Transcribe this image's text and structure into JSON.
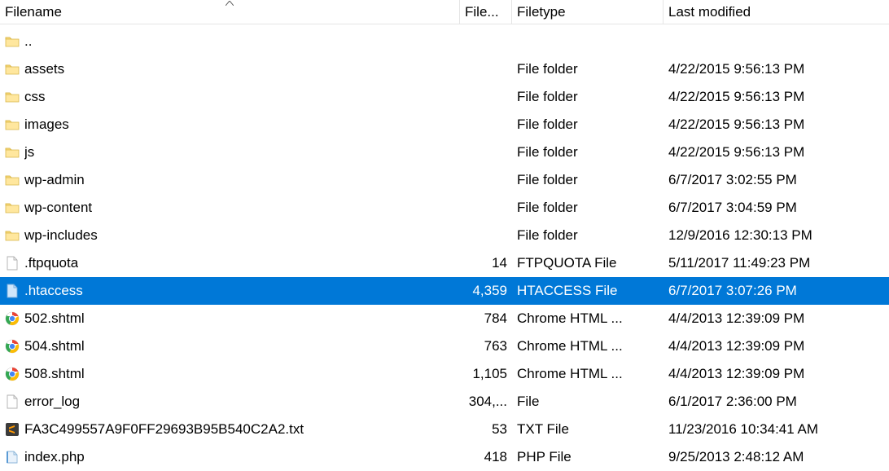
{
  "columns": {
    "filename": "Filename",
    "filesize": "Filesize",
    "filesize_display": "File...",
    "filetype": "Filetype",
    "last_modified": "Last modified"
  },
  "sorted_column": "filename",
  "sort_direction": "asc",
  "rows": [
    {
      "icon": "folder",
      "name": "..",
      "size": "",
      "type": "",
      "date": "",
      "selected": false
    },
    {
      "icon": "folder",
      "name": "assets",
      "size": "",
      "type": "File folder",
      "date": "4/22/2015 9:56:13 PM",
      "selected": false
    },
    {
      "icon": "folder",
      "name": "css",
      "size": "",
      "type": "File folder",
      "date": "4/22/2015 9:56:13 PM",
      "selected": false
    },
    {
      "icon": "folder",
      "name": "images",
      "size": "",
      "type": "File folder",
      "date": "4/22/2015 9:56:13 PM",
      "selected": false
    },
    {
      "icon": "folder",
      "name": "js",
      "size": "",
      "type": "File folder",
      "date": "4/22/2015 9:56:13 PM",
      "selected": false
    },
    {
      "icon": "folder",
      "name": "wp-admin",
      "size": "",
      "type": "File folder",
      "date": "6/7/2017 3:02:55 PM",
      "selected": false
    },
    {
      "icon": "folder",
      "name": "wp-content",
      "size": "",
      "type": "File folder",
      "date": "6/7/2017 3:04:59 PM",
      "selected": false
    },
    {
      "icon": "folder",
      "name": "wp-includes",
      "size": "",
      "type": "File folder",
      "date": "12/9/2016 12:30:13 PM",
      "selected": false
    },
    {
      "icon": "file",
      "name": ".ftpquota",
      "size": "14",
      "type": "FTPQUOTA File",
      "date": "5/11/2017 11:49:23 PM",
      "selected": false
    },
    {
      "icon": "file-sel",
      "name": ".htaccess",
      "size": "4,359",
      "type": "HTACCESS File",
      "date": "6/7/2017 3:07:26 PM",
      "selected": true
    },
    {
      "icon": "chrome",
      "name": "502.shtml",
      "size": "784",
      "type": "Chrome HTML ...",
      "date": "4/4/2013 12:39:09 PM",
      "selected": false
    },
    {
      "icon": "chrome",
      "name": "504.shtml",
      "size": "763",
      "type": "Chrome HTML ...",
      "date": "4/4/2013 12:39:09 PM",
      "selected": false
    },
    {
      "icon": "chrome",
      "name": "508.shtml",
      "size": "1,105",
      "type": "Chrome HTML ...",
      "date": "4/4/2013 12:39:09 PM",
      "selected": false
    },
    {
      "icon": "file",
      "name": "error_log",
      "size": "304,...",
      "type": "File",
      "date": "6/1/2017 2:36:00 PM",
      "selected": false
    },
    {
      "icon": "sublime",
      "name": "FA3C499557A9F0FF29693B95B540C2A2.txt",
      "size": "53",
      "type": "TXT File",
      "date": "11/23/2016 10:34:41 AM",
      "selected": false
    },
    {
      "icon": "php",
      "name": "index.php",
      "size": "418",
      "type": "PHP File",
      "date": "9/25/2013 2:48:12 AM",
      "selected": false
    }
  ]
}
